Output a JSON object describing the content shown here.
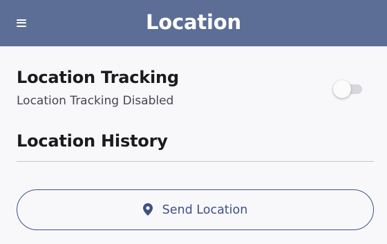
{
  "header": {
    "title": "Location",
    "menu_icon": "menu-icon"
  },
  "tracking": {
    "title": "Location Tracking",
    "status": "Location Tracking Disabled",
    "toggle_on": false
  },
  "history": {
    "title": "Location History"
  },
  "send_button": {
    "label": "Send Location",
    "icon": "location-pin-icon"
  },
  "colors": {
    "header_bg": "#5c6e96",
    "header_text": "#ffffff",
    "background": "#f8f8fb",
    "primary": "#3f5080",
    "heading_text": "#1b1b1f",
    "secondary_text": "#45464f",
    "divider": "#c5c6d0",
    "toggle_track_off": "#d8d8dc"
  }
}
